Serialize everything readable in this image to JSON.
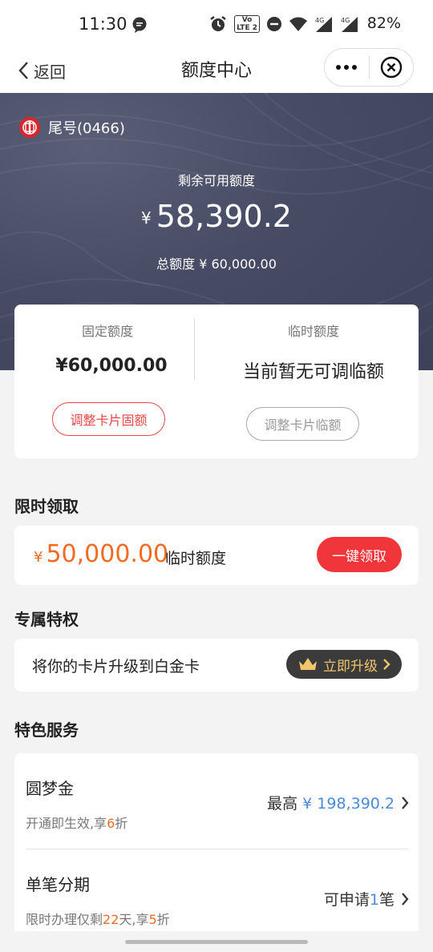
{
  "status_bar": {
    "time": "11:30",
    "lte_badge": "Vo LTE 2",
    "battery": "82%",
    "network_1": "4G",
    "network_2": "4G"
  },
  "nav": {
    "back_label": "返回",
    "title": "额度中心"
  },
  "hero": {
    "card_tail": "尾号(0466)",
    "available_label": "剩余可用额度",
    "currency": "¥",
    "available_amount": "58,390.2",
    "total_label": "总额度",
    "total_amount": "¥ 60,000.00"
  },
  "limit_card": {
    "fixed_title": "固定额度",
    "fixed_value": "¥60,000.00",
    "fixed_button": "调整卡片固额",
    "temp_title": "临时额度",
    "temp_value": "当前暂无可调临额",
    "temp_button": "调整卡片临额"
  },
  "limited_offer": {
    "section_title": "限时领取",
    "currency": "¥",
    "amount": "50,000.00",
    "label": "临时额度",
    "button": "一键领取"
  },
  "privilege": {
    "section_title": "专属特权",
    "text": "将你的卡片升级到白金卡",
    "button": "立即升级"
  },
  "services": {
    "section_title": "特色服务",
    "items": [
      {
        "name": "圆梦金",
        "desc_prefix": "开通即生效,享",
        "desc_highlight": "6",
        "desc_suffix": "折",
        "right_prefix": "最高",
        "right_value": "¥ 198,390.2",
        "right_suffix": ""
      },
      {
        "name": "单笔分期",
        "desc_prefix": "限时办理仅剩",
        "desc_highlight": "22",
        "desc_mid": "天,享",
        "desc_highlight2": "5",
        "desc_suffix": "折",
        "right_prefix": "可申请",
        "right_value": "1",
        "right_suffix": "笔"
      }
    ]
  },
  "colors": {
    "accent_red": "#f0353b",
    "accent_orange": "#f36b22",
    "accent_blue": "#4a8ae0",
    "hero_bg": "#474c64"
  }
}
